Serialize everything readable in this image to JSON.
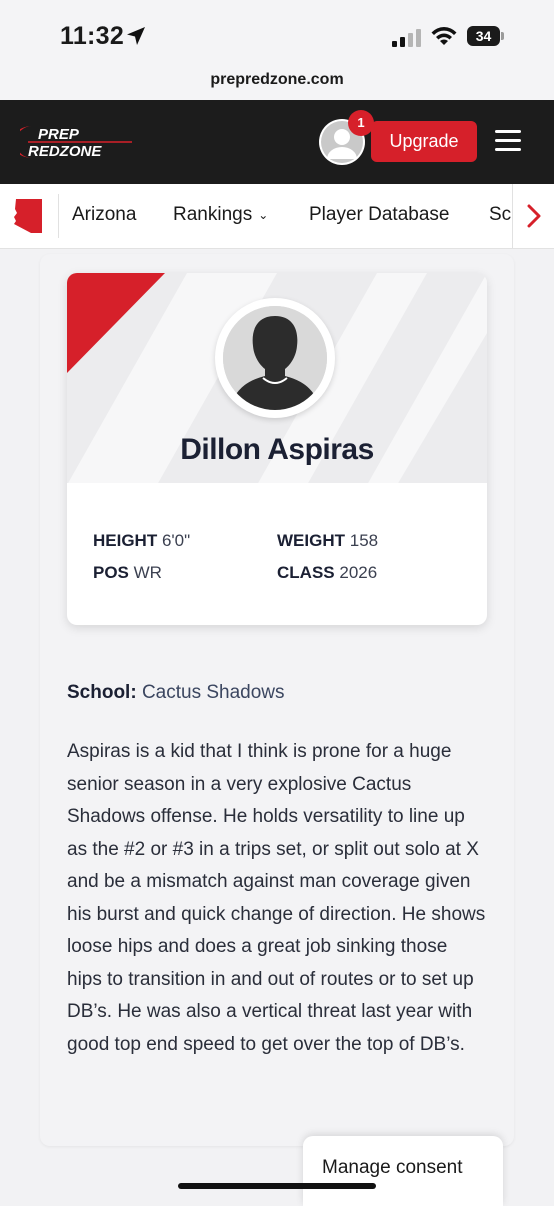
{
  "status_bar": {
    "time": "11:32",
    "battery": "34"
  },
  "browser": {
    "url": "prepredzone.com"
  },
  "header": {
    "logo_top": "PREP",
    "logo_bottom": "REDZONE",
    "notification_count": "1",
    "upgrade_label": "Upgrade",
    "accent_color": "#d6202a"
  },
  "subnav": {
    "items": [
      {
        "label": "Arizona"
      },
      {
        "label": "Rankings"
      },
      {
        "label": "Player Database"
      },
      {
        "label": "Sc"
      }
    ]
  },
  "player": {
    "name": "Dillon Aspiras",
    "stats": {
      "height_label": "HEIGHT",
      "height_value": "6'0\"",
      "weight_label": "WEIGHT",
      "weight_value": "158",
      "pos_label": "POS",
      "pos_value": "WR",
      "class_label": "CLASS",
      "class_value": "2026"
    },
    "school_label": "School:",
    "school_value": "Cactus Shadows",
    "bio": "Aspiras is a kid that I think is prone for a huge senior season in a very explosive Cactus Shadows offense. He holds versatility to line up as the #2 or #3 in a trips set, or split out solo at X and be a mismatch against man coverage given his burst and quick change of direction. He shows loose hips and does a great job sinking those hips to transition in and out of routes or to set up DB’s. He was also a vertical threat last year with good top end speed to get over the top of DB’s."
  },
  "consent": {
    "label": "Manage consent"
  }
}
